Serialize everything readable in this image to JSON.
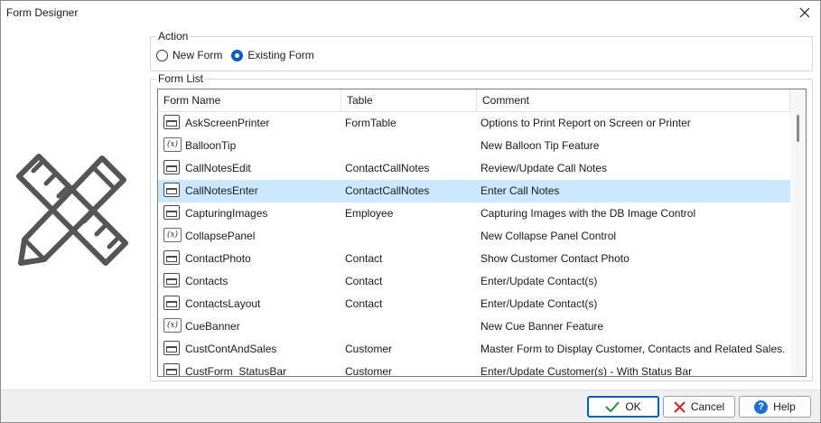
{
  "window": {
    "title": "Form Designer"
  },
  "action": {
    "label": "Action",
    "options": [
      {
        "label": "New Form",
        "selected": false
      },
      {
        "label": "Existing Form",
        "selected": true
      }
    ]
  },
  "form_list": {
    "label": "Form List",
    "columns": [
      "Form Name",
      "Table",
      "Comment"
    ],
    "rows": [
      {
        "icon": "form-icon",
        "name": "AskScreenPrinter",
        "table": "FormTable",
        "comment": "Options to Print Report on Screen or Printer"
      },
      {
        "icon": "variable-icon",
        "name": "BalloonTip",
        "table": "",
        "comment": "New Balloon Tip Feature"
      },
      {
        "icon": "form-icon",
        "name": "CallNotesEdit",
        "table": "ContactCallNotes",
        "comment": "Review/Update Call Notes"
      },
      {
        "icon": "form-icon",
        "name": "CallNotesEnter",
        "table": "ContactCallNotes",
        "comment": "Enter Call Notes",
        "selected": true
      },
      {
        "icon": "form-icon",
        "name": "CapturingImages",
        "table": "Employee",
        "comment": "Capturing Images with the DB Image Control"
      },
      {
        "icon": "variable-icon",
        "name": "CollapsePanel",
        "table": "",
        "comment": "New Collapse Panel Control"
      },
      {
        "icon": "form-icon",
        "name": "ContactPhoto",
        "table": "Contact",
        "comment": "Show Customer Contact Photo"
      },
      {
        "icon": "form-icon",
        "name": "Contacts",
        "table": "Contact",
        "comment": "Enter/Update Contact(s)"
      },
      {
        "icon": "form-icon",
        "name": "ContactsLayout",
        "table": "Contact",
        "comment": "Enter/Update Contact(s)"
      },
      {
        "icon": "variable-icon",
        "name": "CueBanner",
        "table": "",
        "comment": "New Cue Banner Feature"
      },
      {
        "icon": "form-icon",
        "name": "CustContAndSales",
        "table": "Customer",
        "comment": "Master Form to Display Customer, Contacts and Related Sales..."
      },
      {
        "icon": "form-icon",
        "name": "CustForm_StatusBar",
        "table": "Customer",
        "comment": "Enter/Update Customer(s) - With Status Bar"
      }
    ],
    "variable_icon_glyph": "(x)"
  },
  "buttons": {
    "ok": "OK",
    "cancel": "Cancel",
    "help": "Help",
    "help_glyph": "?"
  },
  "colors": {
    "selection": "#cce8ff",
    "accent": "#005fb8",
    "ok_check": "#2e8b3d",
    "cancel_x": "#c62828"
  }
}
